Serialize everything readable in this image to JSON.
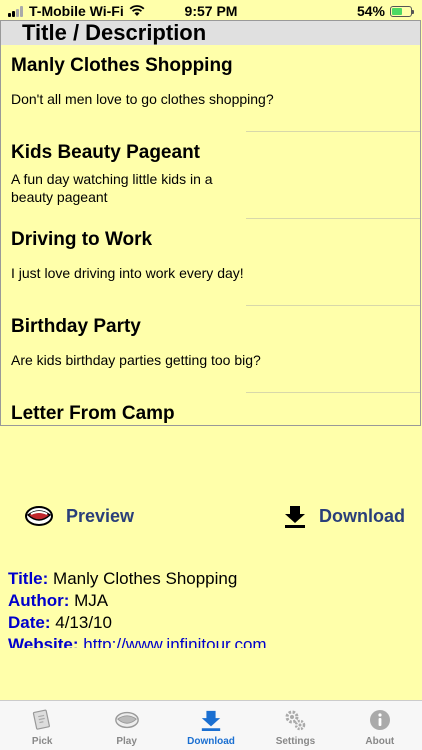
{
  "status": {
    "carrier": "T-Mobile Wi-Fi",
    "time": "9:57 PM",
    "battery": "54%",
    "battery_level": 0.54
  },
  "list": {
    "header": "Title / Description",
    "items": [
      {
        "title": "Manly Clothes Shopping",
        "desc": "Don't all men love to go clothes shopping?"
      },
      {
        "title": "Kids Beauty Pageant",
        "desc": "A fun day watching little kids in a beauty pageant"
      },
      {
        "title": "Driving to Work",
        "desc": "I just love driving into work every day!"
      },
      {
        "title": "Birthday Party",
        "desc": "Are kids birthday parties getting too big?"
      },
      {
        "title": "Letter From Camp",
        "desc": ""
      }
    ]
  },
  "actions": {
    "preview_label": "Preview",
    "download_label": "Download"
  },
  "details": {
    "title_label": "Title:",
    "title_value": "Manly Clothes Shopping",
    "author_label": "Author:",
    "author_value": "MJA",
    "date_label": "Date:",
    "date_value": "4/13/10",
    "website_label": "Website:",
    "website_value": "http://www.infinitour.com"
  },
  "tabs": [
    {
      "label": "Pick",
      "icon": "pick-icon"
    },
    {
      "label": "Play",
      "icon": "play-icon"
    },
    {
      "label": "Download",
      "icon": "download-icon"
    },
    {
      "label": "Settings",
      "icon": "settings-icon"
    },
    {
      "label": "About",
      "icon": "about-icon"
    }
  ],
  "colors": {
    "background": "#ffffaa",
    "action_text": "#2a3f7a",
    "label_blue": "#0000cc",
    "active_tab": "#1a6fd1"
  }
}
